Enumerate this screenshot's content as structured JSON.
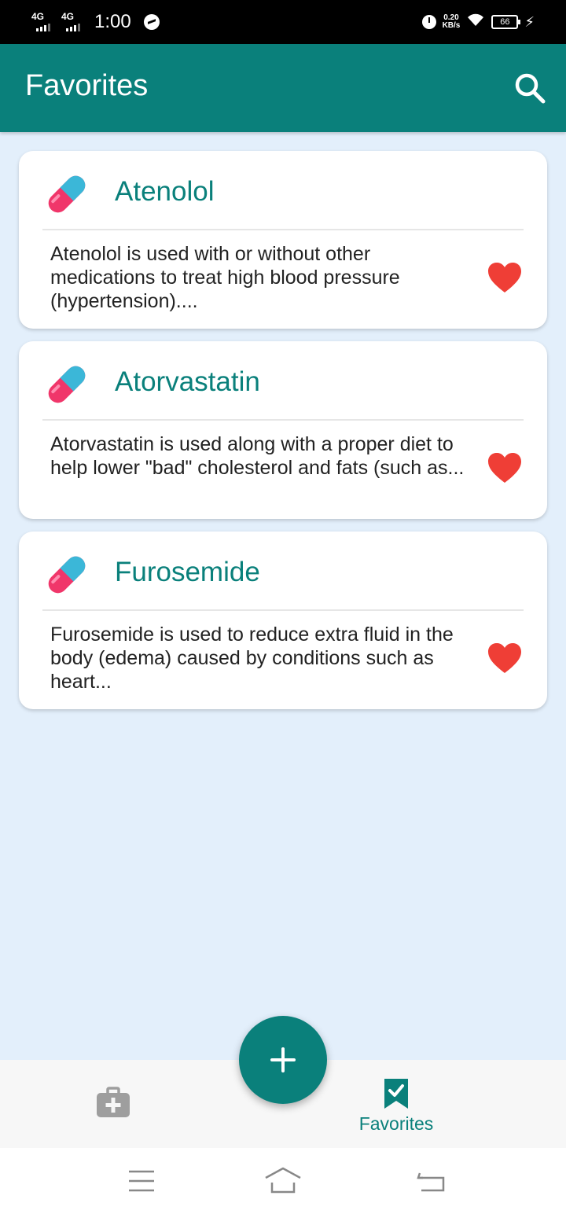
{
  "status_bar": {
    "network1": "4G",
    "network2": "4G",
    "time": "1:00",
    "speed_value": "0.20",
    "speed_unit": "KB/s",
    "battery": "66"
  },
  "app_bar": {
    "title": "Favorites",
    "search_icon": "search-icon"
  },
  "medications": [
    {
      "name": "Atenolol",
      "description": "Atenolol is used with or without other medications to treat high blood pressure (hypertension)....",
      "icon": "pill-icon",
      "favorite": true
    },
    {
      "name": "Atorvastatin",
      "description": "Atorvastatin is used along with a proper diet to help lower \"bad\" cholesterol and fats (such as...",
      "icon": "pill-icon",
      "favorite": true
    },
    {
      "name": "Furosemide",
      "description": "Furosemide is used to reduce extra fluid in the body (edema) caused by conditions such as heart...",
      "icon": "pill-icon",
      "favorite": true
    }
  ],
  "fab": {
    "icon": "plus-icon"
  },
  "bottom_nav": {
    "items": [
      {
        "icon": "medical-kit-icon",
        "label": "",
        "active": false
      },
      {
        "icon": "bookmark-check-icon",
        "label": "Favorites",
        "active": true
      }
    ]
  },
  "colors": {
    "primary": "#0a807b",
    "background": "#e3effb",
    "heart": "#ef3e36",
    "inactive_icon": "#9e9e9e"
  }
}
